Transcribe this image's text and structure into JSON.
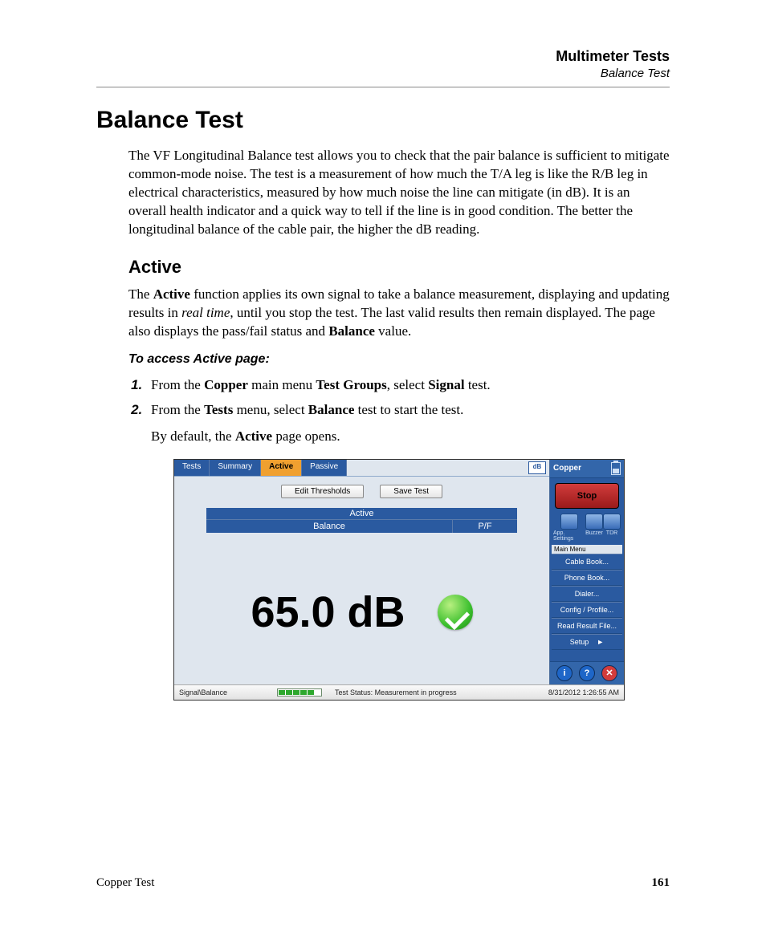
{
  "header": {
    "chapter": "Multimeter Tests",
    "section": "Balance Test"
  },
  "title": "Balance Test",
  "intro": "The VF Longitudinal Balance test allows you to check that the pair balance is sufficient to mitigate common-mode noise. The test is a measurement of how much the T/A leg is like the R/B leg in electrical characteristics, measured by how much noise the line can mitigate (in dB). It is an overall health indicator and a quick way to tell if the line is in good condition. The better the longitudinal balance of the cable pair, the higher the dB reading.",
  "sub_heading": "Active",
  "active_para": {
    "pre": "The ",
    "b1": "Active",
    "mid1": " function applies its own signal to take a balance measurement, displaying and updating results in ",
    "em1": "real time",
    "mid2": ", until you stop the test. The last valid results then remain displayed. The page also displays the pass/fail status and ",
    "b2": "Balance",
    "post": " value."
  },
  "instr_head": "To access Active page:",
  "steps": {
    "s1": {
      "pre": "From the ",
      "b1": "Copper",
      "mid1": " main menu ",
      "b2": "Test Groups",
      "mid2": ", select ",
      "b3": "Signal",
      "post": " test."
    },
    "s2": {
      "pre": "From the ",
      "b1": "Tests",
      "mid1": " menu, select ",
      "b2": "Balance",
      "post": " test to start the test."
    },
    "followup": {
      "pre": "By default, the ",
      "b1": "Active",
      "post": " page opens."
    }
  },
  "screenshot": {
    "tabs": {
      "tests": "Tests",
      "summary": "Summary",
      "active": "Active",
      "passive": "Passive"
    },
    "db_badge": "dB",
    "toolbar": {
      "edit": "Edit Thresholds",
      "save": "Save Test"
    },
    "table": {
      "head": "Active",
      "balance": "Balance",
      "pf": "P/F"
    },
    "reading": "65.0 dB",
    "side": {
      "title": "Copper",
      "stop": "Stop",
      "icons": {
        "app": "App. Settings",
        "buzzer": "Buzzer",
        "tdr": "TDR"
      },
      "menu_label": "Main Menu",
      "items": [
        "Cable Book...",
        "Phone Book...",
        "Dialer...",
        "Config / Profile...",
        "Read Result File...",
        "Setup"
      ],
      "arrow": "►"
    },
    "status": {
      "path": "Signal\\Balance",
      "msg": "Test Status: Measurement in progress",
      "time": "8/31/2012 1:26:55 AM"
    }
  },
  "footer": {
    "left": "Copper Test",
    "page": "161"
  }
}
